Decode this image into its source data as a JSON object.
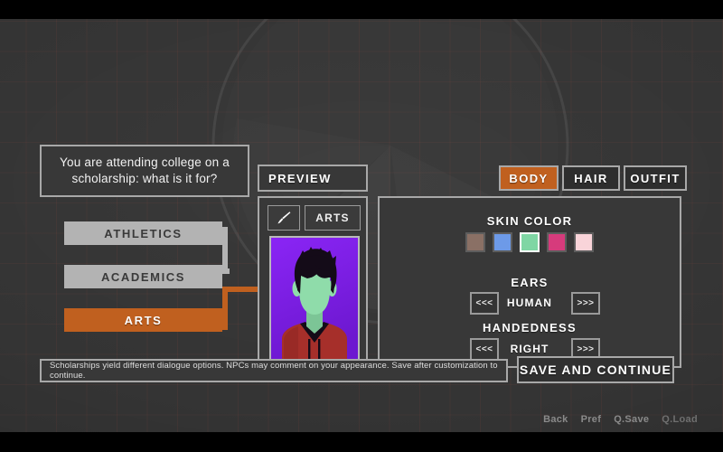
{
  "question": {
    "text": "You are attending college on a scholarship: what is it for?"
  },
  "choices": [
    {
      "label": "ATHLETICS",
      "selected": false
    },
    {
      "label": "ACADEMICS",
      "selected": false
    },
    {
      "label": "ARTS",
      "selected": true
    }
  ],
  "preview": {
    "label": "PREVIEW",
    "brush_icon": "paintbrush-icon",
    "tag": "ARTS",
    "portrait": {
      "background_color": "#7a1fe8",
      "skin_color": "#8fdcaa",
      "hair_color": "#140b18",
      "shirt_color": "#a62f2a",
      "collar_color": "#140b18"
    }
  },
  "tabs": [
    {
      "label": "BODY",
      "active": true
    },
    {
      "label": "HAIR",
      "active": false
    },
    {
      "label": "OUTFIT",
      "active": false
    }
  ],
  "options": {
    "skin_color": {
      "label": "SKIN COLOR",
      "swatches": [
        {
          "color": "#8a7065",
          "selected": false
        },
        {
          "color": "#6d9ae8",
          "selected": false
        },
        {
          "color": "#7fd6a4",
          "selected": true
        },
        {
          "color": "#d63b7c",
          "selected": false
        },
        {
          "color": "#f9d4d9",
          "selected": false
        }
      ]
    },
    "ears": {
      "label": "EARS",
      "value": "HUMAN",
      "prev": "<<<",
      "next": ">>>"
    },
    "handedness": {
      "label": "HANDEDNESS",
      "value": "RIGHT",
      "prev": "<<<",
      "next": ">>>"
    }
  },
  "status": {
    "text": "Scholarships yield different dialogue options. NPCs may comment on your appearance. Save after customization to continue."
  },
  "save_button": {
    "label": "SAVE AND CONTINUE"
  },
  "quick_menu": [
    {
      "label": "Back"
    },
    {
      "label": "Pref"
    },
    {
      "label": "Q.Save"
    },
    {
      "label": "Q.Load"
    }
  ],
  "theme": {
    "accent": "#c0601f",
    "panel_bg": "#383838",
    "canvas_bg": "#343434",
    "border": "#a8a8a8"
  }
}
